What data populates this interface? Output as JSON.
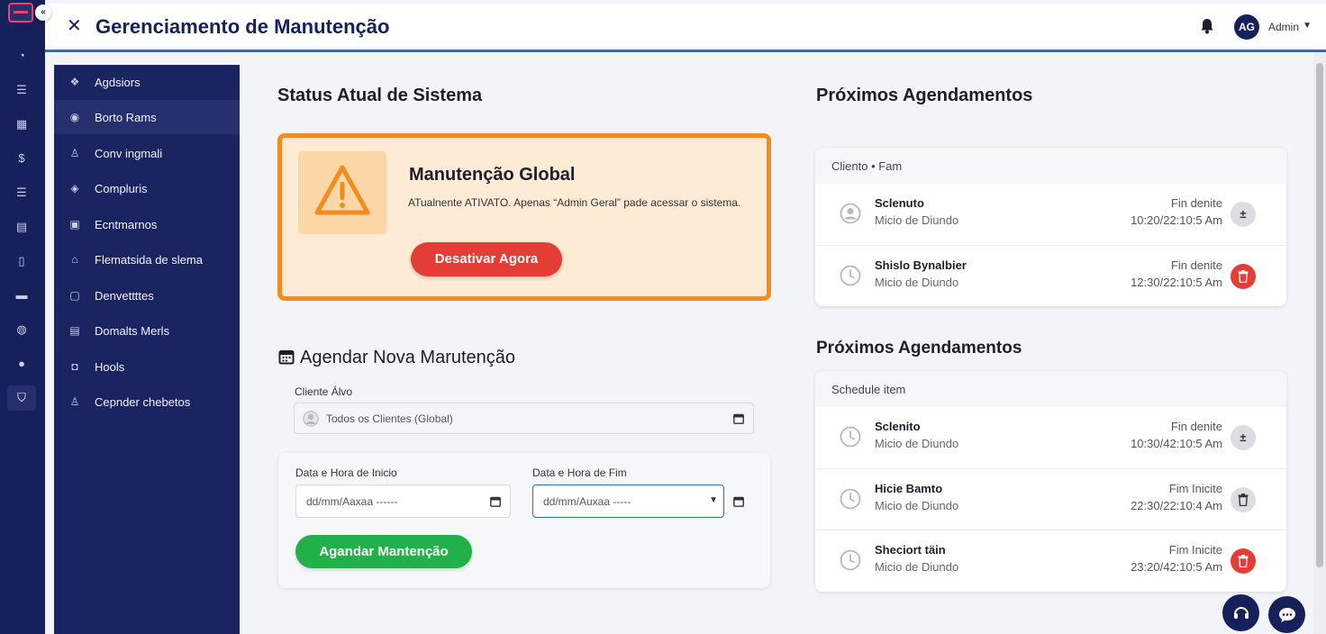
{
  "app": {
    "title": "Gerenciamento de Manutenção",
    "user_name": "Admin",
    "user_initials": "AG"
  },
  "rail": {
    "icons": [
      "dashboard-icon",
      "list-icon",
      "calendar-icon",
      "dollar-icon",
      "list2-icon",
      "server-icon",
      "document-icon",
      "window-icon",
      "support-icon",
      "users-icon",
      "shield-icon"
    ]
  },
  "sidebar": {
    "items": [
      {
        "label": "Agdsiors",
        "icon": "users-icon"
      },
      {
        "label": "Borto Rams",
        "icon": "gauge-icon"
      },
      {
        "label": "Conv ingmali",
        "icon": "user-icon"
      },
      {
        "label": "Compluris",
        "icon": "layers-icon"
      },
      {
        "label": "Ecntmarnos",
        "icon": "document-icon"
      },
      {
        "label": "Flematsida de slema",
        "icon": "lock-icon"
      },
      {
        "label": "Denvettttes",
        "icon": "edit-icon"
      },
      {
        "label": "Domalts Merls",
        "icon": "document2-icon"
      },
      {
        "label": "Hools",
        "icon": "tool-icon"
      },
      {
        "label": "Cepnder chebetos",
        "icon": "person-icon"
      }
    ]
  },
  "status": {
    "heading": "Status Atual de Sistema",
    "title": "Manutenção Global",
    "description": "ATualnente ATIVATO. Apenas “Admin Geral” pade acessar o sistema.",
    "button": "Desativar Agora"
  },
  "schedule_form": {
    "heading": "Agendar Nova Marutenção",
    "client_label": "Cliente Álvo",
    "client_value": "Todos os Clientes (Global)",
    "start_label": "Data e Hora de Inicio",
    "start_placeholder": "dd/mm/Aaxaa ------",
    "end_label": "Data e Hora de Fim",
    "end_placeholder": "dd/mm/Auxaa -----",
    "button": "Agandar Mantenção"
  },
  "upcoming_1": {
    "heading": "Próximos Agendamentos",
    "header": "Cliento • Fam",
    "rows": [
      {
        "name": "Sclenuto",
        "sub": "Micio de Diundo",
        "r1": "Fin denite",
        "r2": "10:20/22:10:5 Am",
        "action": "gray"
      },
      {
        "name": "Shislo Bynalbier",
        "sub": "Micio de Diundo",
        "r1": "Fin denite",
        "r2": "12:30/22:10:5 Am",
        "action": "red"
      }
    ]
  },
  "upcoming_2": {
    "heading": "Próximos Agendamentos",
    "header": "Schedule item",
    "rows": [
      {
        "name": "Sclenito",
        "sub": "Micio de Diundo",
        "r1": "Fin denite",
        "r2": "10:30/42:10:5 Am",
        "action": "gray"
      },
      {
        "name": "Hicie Bamto",
        "sub": "Micio de Diundo",
        "r1": "Fim Inicite",
        "r2": "22:30/22:10:4 Am",
        "action": "gray"
      },
      {
        "name": "Sheciort täin",
        "sub": "Micio de Diundo",
        "r1": "Fim Inicite",
        "r2": "23:20/42:10:5 Am",
        "action": "red"
      }
    ]
  },
  "colors": {
    "navy": "#16205a",
    "accent_orange": "#f28c1f",
    "danger": "#e43d35",
    "success": "#22b04b",
    "link_blue": "#2e6bc6"
  }
}
